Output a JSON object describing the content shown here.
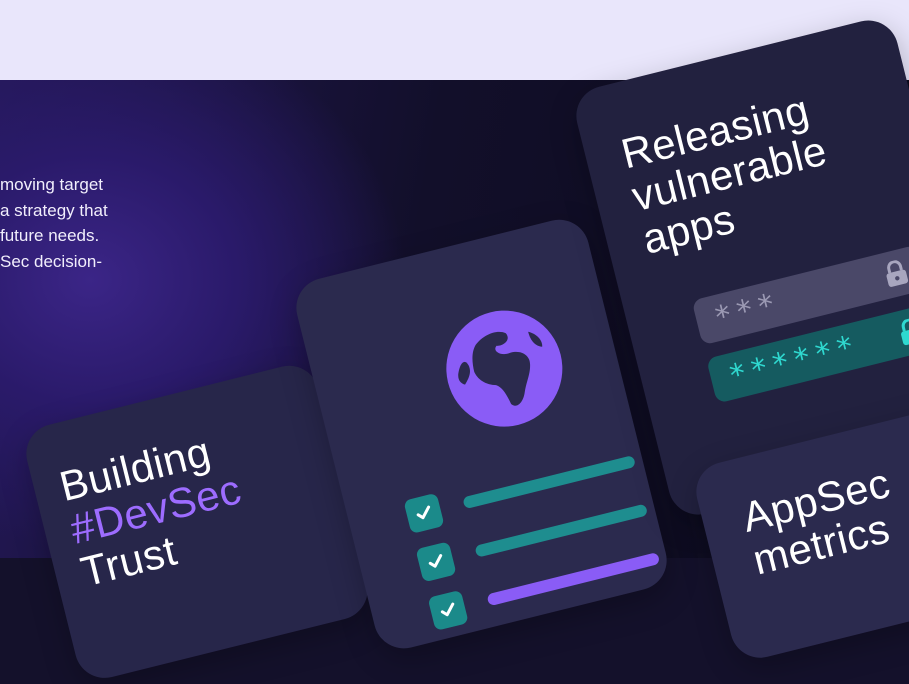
{
  "colors": {
    "top_band": "#e9e6fb",
    "card": "#27264a",
    "accent_purple": "#9d6cff",
    "teal": "#1b8a8a",
    "teal_text": "#2fd9d0"
  },
  "copy": {
    "line1": "moving target",
    "line2": "a strategy that",
    "line3": "future needs.",
    "line4": "Sec decision-"
  },
  "cards": {
    "building": {
      "line1": "Building",
      "line2": "#DevSec",
      "line3": "Trust"
    },
    "checklist": {
      "globe_icon": "globe-icon",
      "items": [
        {
          "icon": "check-icon",
          "bar_color": "#1e8d8f"
        },
        {
          "icon": "check-icon",
          "bar_color": "#1e8d8f"
        },
        {
          "icon": "check-icon",
          "bar_color": "#8a5cf6"
        }
      ]
    },
    "releasing": {
      "line1": "Releasing",
      "line2": "vulnerable",
      "line3": "apps",
      "weak_password": "***",
      "strong_password": "******"
    },
    "appsec": {
      "line1": "AppSec",
      "line2": "metrics"
    }
  }
}
